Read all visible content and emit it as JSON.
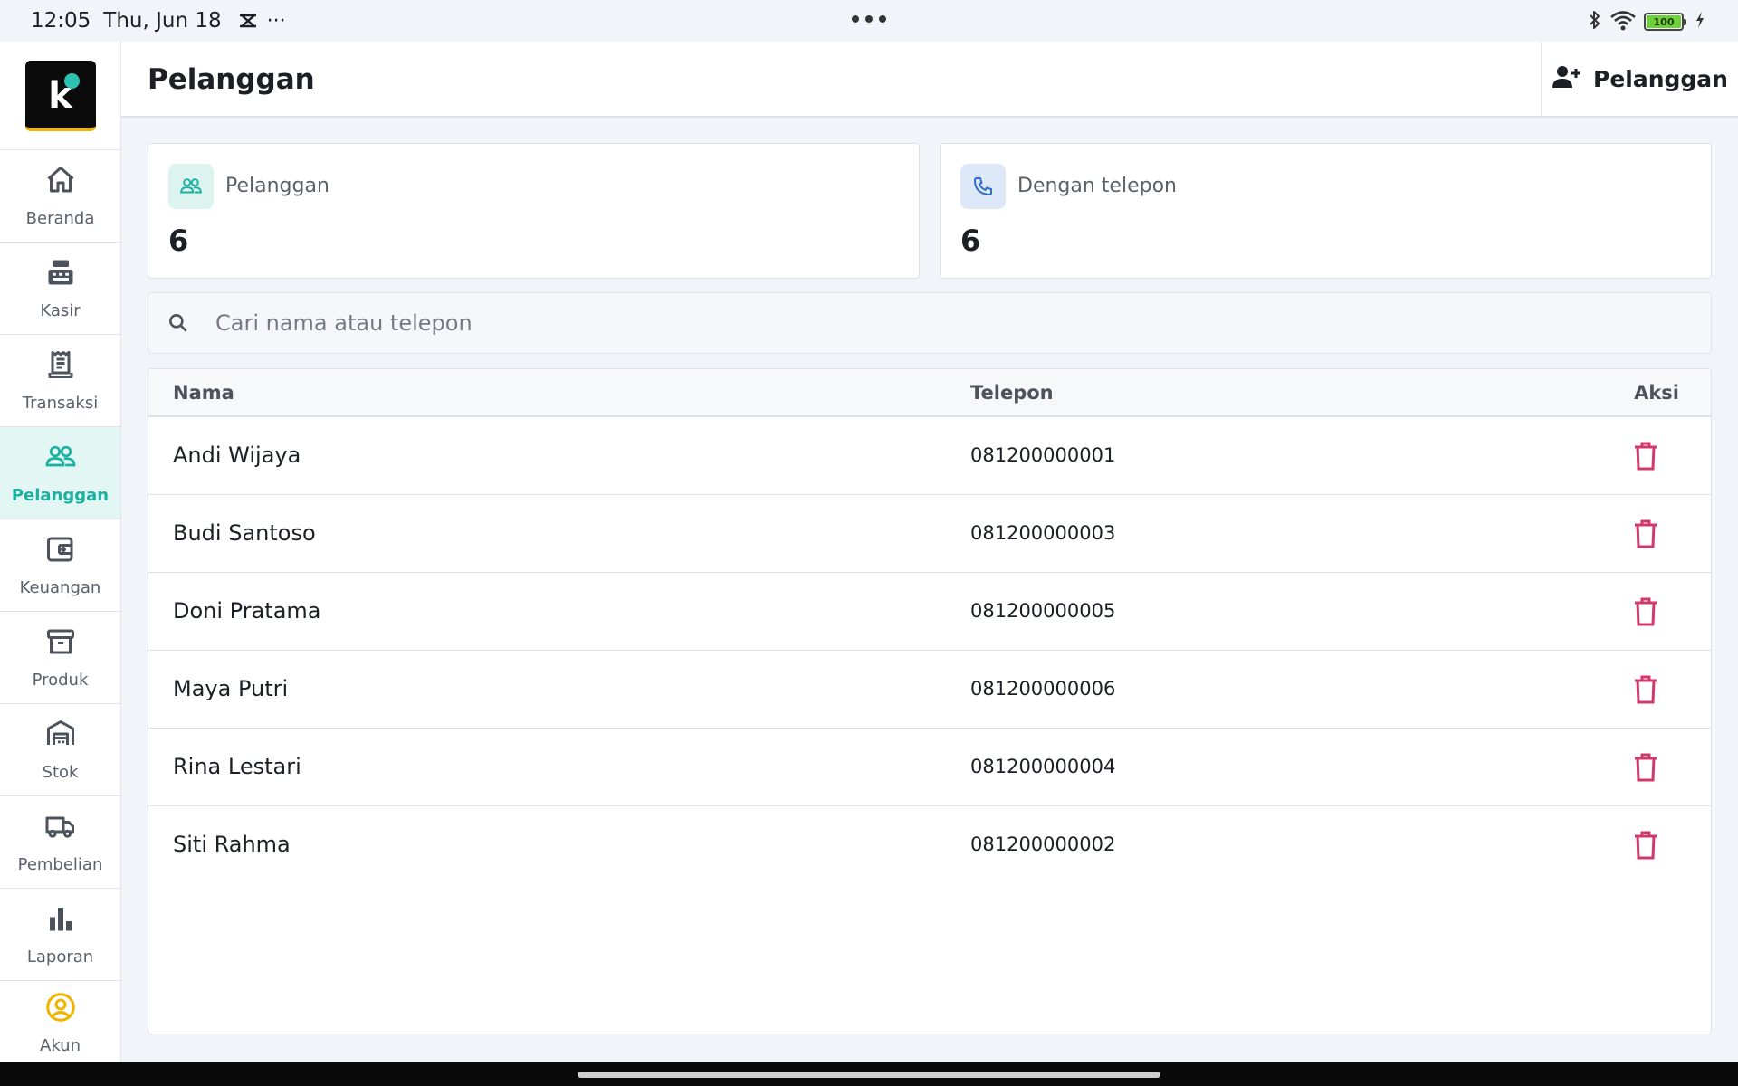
{
  "status_bar": {
    "time": "12:05",
    "date": "Thu, Jun 18",
    "more": "···",
    "battery": "100"
  },
  "sidebar": {
    "logo_letter": "k",
    "items": [
      {
        "label": "Beranda",
        "icon": "home-icon"
      },
      {
        "label": "Kasir",
        "icon": "cash-register-icon"
      },
      {
        "label": "Transaksi",
        "icon": "receipt-icon"
      },
      {
        "label": "Pelanggan",
        "icon": "users-icon",
        "active": true
      },
      {
        "label": "Keuangan",
        "icon": "wallet-icon"
      },
      {
        "label": "Produk",
        "icon": "archive-box-icon"
      },
      {
        "label": "Stok",
        "icon": "warehouse-icon"
      },
      {
        "label": "Pembelian",
        "icon": "truck-icon"
      },
      {
        "label": "Laporan",
        "icon": "bar-chart-icon"
      },
      {
        "label": "Akun",
        "icon": "account-circle-icon"
      }
    ]
  },
  "header": {
    "title": "Pelanggan",
    "add_button_label": "Pelanggan"
  },
  "stats": [
    {
      "label": "Pelanggan",
      "value": "6",
      "icon": "users-icon"
    },
    {
      "label": "Dengan telepon",
      "value": "6",
      "icon": "phone-icon"
    }
  ],
  "search": {
    "placeholder": "Cari nama atau telepon",
    "value": ""
  },
  "table": {
    "columns": [
      "Nama",
      "Telepon",
      "Aksi"
    ],
    "rows": [
      {
        "name": "Andi Wijaya",
        "phone": "081200000001"
      },
      {
        "name": "Budi Santoso",
        "phone": "081200000003"
      },
      {
        "name": "Doni Pratama",
        "phone": "081200000005"
      },
      {
        "name": "Maya Putri",
        "phone": "081200000006"
      },
      {
        "name": "Rina Lestari",
        "phone": "081200000004"
      },
      {
        "name": "Siti Rahma",
        "phone": "081200000002"
      }
    ]
  },
  "colors": {
    "accent": "#1bb0a0",
    "delete": "#d0396a",
    "account": "#f0b400"
  }
}
